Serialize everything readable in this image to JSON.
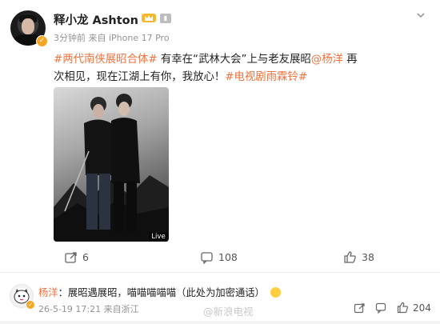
{
  "post": {
    "username": "释小龙 Ashton",
    "meta": "3分钟前  来自 iPhone 17 Pro",
    "text": {
      "tag1": "#两代南侠展昭合体#",
      "part1": " 有幸在“武林大会”上与老友展昭",
      "mention": "@杨洋",
      "part2": " 再次相见，现在江湖上有你，我放心！",
      "tag2": "#电视剧雨霖铃#"
    },
    "image_badge": "Live"
  },
  "actions": {
    "repost": "6",
    "comments": "108",
    "likes": "38"
  },
  "comment": {
    "name": "杨洋",
    "text": "：展昭遇展昭，喵喵喵喵喵（此处为加密通话）",
    "meta": "26-5-19 17:21  来自浙江",
    "reply_count": "",
    "likes": "204"
  },
  "watermark": "@新浪电视",
  "colors": {
    "link": "#eb7340",
    "vip_gold": "#f5a623"
  },
  "icons": [
    "chevron-down-icon",
    "verified-badge-icon",
    "vip-crown-icon",
    "repost-icon",
    "comment-icon",
    "like-icon",
    "emoji-icon"
  ]
}
